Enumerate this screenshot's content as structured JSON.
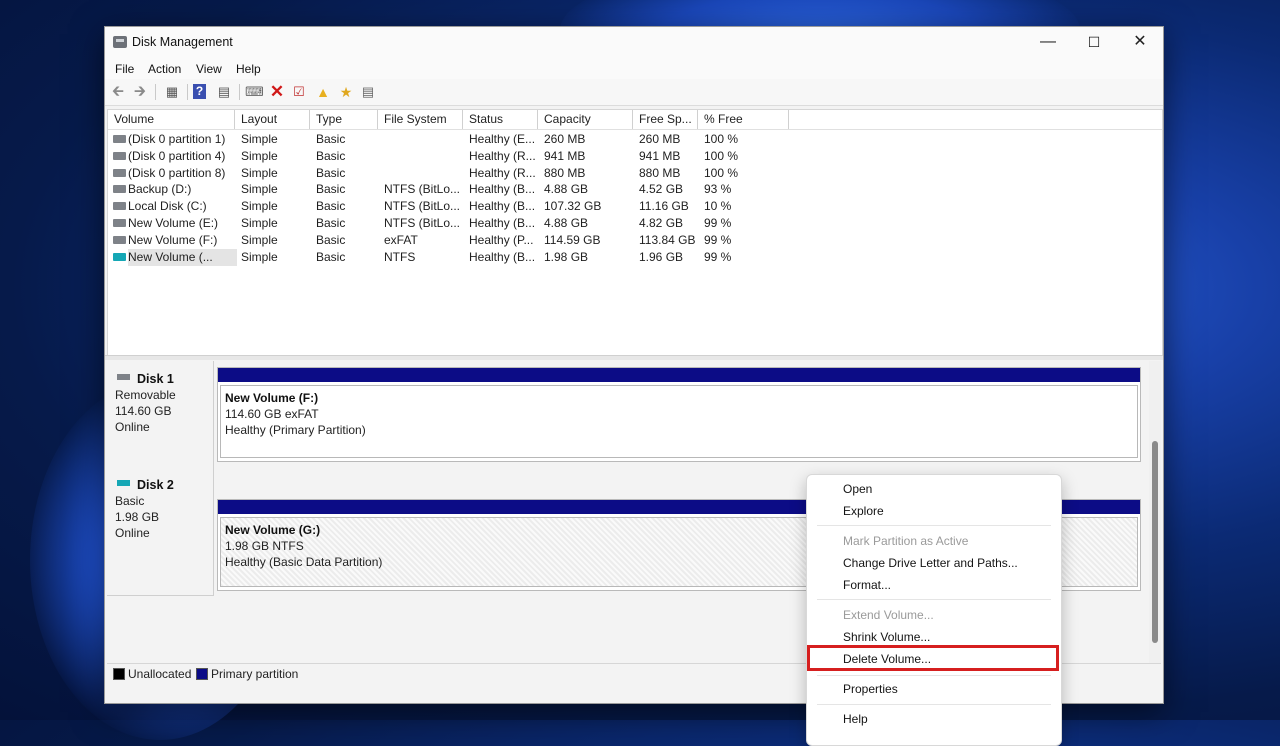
{
  "window": {
    "title": "Disk Management"
  },
  "menu": [
    "File",
    "Action",
    "View",
    "Help"
  ],
  "toolbar_icons": [
    "back-arrow-icon",
    "forward-arrow-icon",
    "console-tree-icon",
    "help-icon",
    "properties-icon",
    "connect-icon",
    "delete-icon",
    "check-icon",
    "folder-up-icon",
    "folder-search-icon",
    "panel-icon"
  ],
  "volume_list": {
    "columns": [
      "Volume",
      "Layout",
      "Type",
      "File System",
      "Status",
      "Capacity",
      "Free Sp...",
      "% Free"
    ],
    "rows": [
      [
        "(Disk 0 partition 1)",
        "Simple",
        "Basic",
        "",
        "Healthy (E...",
        "260 MB",
        "260 MB",
        "100 %"
      ],
      [
        "(Disk 0 partition 4)",
        "Simple",
        "Basic",
        "",
        "Healthy (R...",
        "941 MB",
        "941 MB",
        "100 %"
      ],
      [
        "(Disk 0 partition 8)",
        "Simple",
        "Basic",
        "",
        "Healthy (R...",
        "880 MB",
        "880 MB",
        "100 %"
      ],
      [
        "Backup (D:)",
        "Simple",
        "Basic",
        "NTFS (BitLo...",
        "Healthy (B...",
        "4.88 GB",
        "4.52 GB",
        "93 %"
      ],
      [
        "Local Disk (C:)",
        "Simple",
        "Basic",
        "NTFS (BitLo...",
        "Healthy (B...",
        "107.32 GB",
        "11.16 GB",
        "10 %"
      ],
      [
        "New Volume (E:)",
        "Simple",
        "Basic",
        "NTFS (BitLo...",
        "Healthy (B...",
        "4.88 GB",
        "4.82 GB",
        "99 %"
      ],
      [
        "New Volume (F:)",
        "Simple",
        "Basic",
        "exFAT",
        "Healthy (P...",
        "114.59 GB",
        "113.84 GB",
        "99 %"
      ],
      [
        "New Volume (...",
        "Simple",
        "Basic",
        "NTFS",
        "Healthy (B...",
        "1.98 GB",
        "1.96 GB",
        "99 %"
      ]
    ]
  },
  "disks": [
    {
      "name": "Disk 1",
      "kind": "Removable",
      "size": "114.60 GB",
      "state": "Online",
      "partition": {
        "name": "New Volume  (F:)",
        "detail": "114.60 GB exFAT",
        "status": "Healthy (Primary Partition)"
      }
    },
    {
      "name": "Disk 2",
      "kind": "Basic",
      "size": "1.98 GB",
      "state": "Online",
      "partition": {
        "name": "New Volume  (G:)",
        "detail": "1.98 GB NTFS",
        "status": "Healthy (Basic Data Partition)"
      }
    }
  ],
  "legend": {
    "unallocated": "Unallocated",
    "primary": "Primary partition",
    "unallocated_color": "#000000",
    "primary_color": "#0c0c86"
  },
  "context_menu": {
    "open": "Open",
    "explore": "Explore",
    "mark_active": "Mark Partition as Active",
    "change_letter": "Change Drive Letter and Paths...",
    "format": "Format...",
    "extend": "Extend Volume...",
    "shrink": "Shrink Volume...",
    "delete": "Delete Volume...",
    "properties": "Properties",
    "help": "Help"
  },
  "highlight_color": "#d61f1f"
}
